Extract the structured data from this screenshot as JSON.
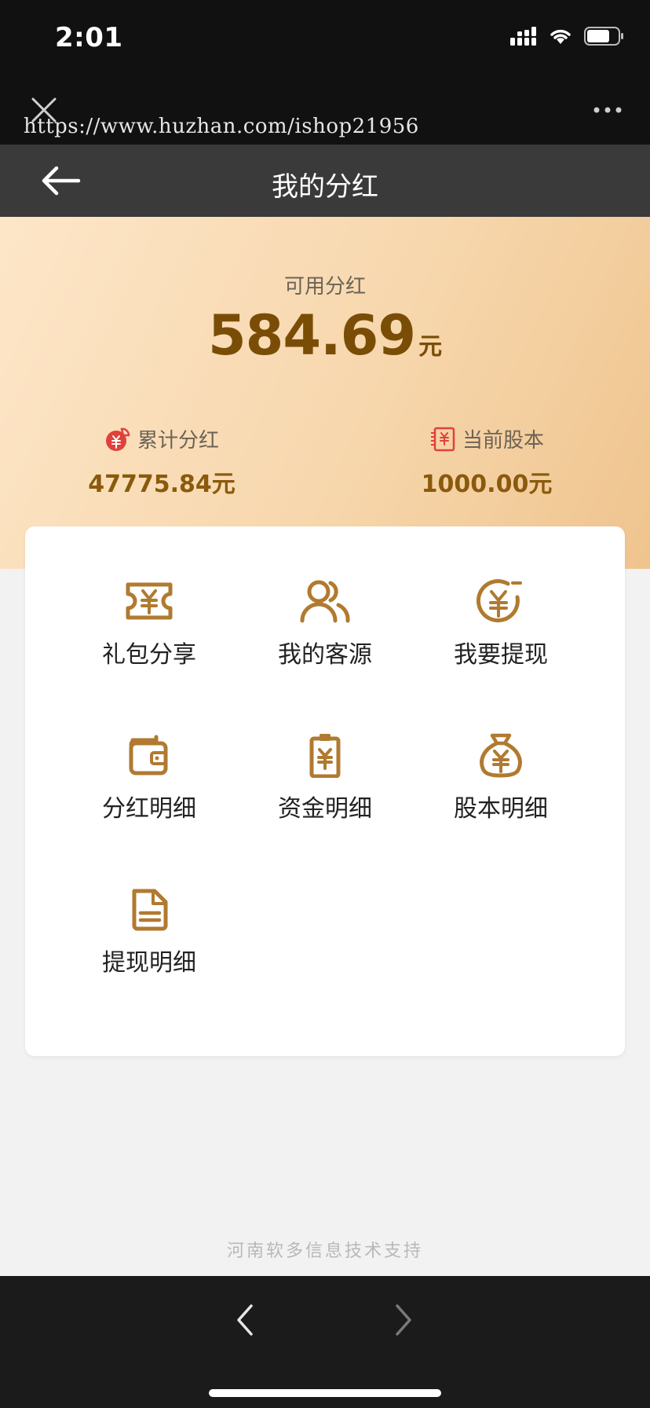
{
  "status_bar": {
    "time": "2:01"
  },
  "browser": {
    "url": "https://www.huzhan.com/ishop21956"
  },
  "nav": {
    "title": "我的分红"
  },
  "hero": {
    "label": "可用分红",
    "amount": "584.69",
    "unit": "元",
    "stats": [
      {
        "label": "累计分红",
        "value": "47775.84元",
        "icon": "red-envelope-icon"
      },
      {
        "label": "当前股本",
        "value": "1000.00元",
        "icon": "stock-bill-icon"
      }
    ]
  },
  "menu": [
    {
      "label": "礼包分享",
      "icon": "gift-ticket-icon"
    },
    {
      "label": "我的客源",
      "icon": "customers-icon"
    },
    {
      "label": "我要提现",
      "icon": "withdraw-coin-icon"
    },
    {
      "label": "分红明细",
      "icon": "wallet-icon"
    },
    {
      "label": "资金明细",
      "icon": "clipboard-yen-icon"
    },
    {
      "label": "股本明细",
      "icon": "money-bag-icon"
    },
    {
      "label": "提现明细",
      "icon": "document-icon"
    }
  ],
  "footer": {
    "text": "河南软多信息技术支持"
  },
  "colors": {
    "accent": "#b07a30",
    "amount": "#7a4d06",
    "icon_red": "#e0413b"
  }
}
